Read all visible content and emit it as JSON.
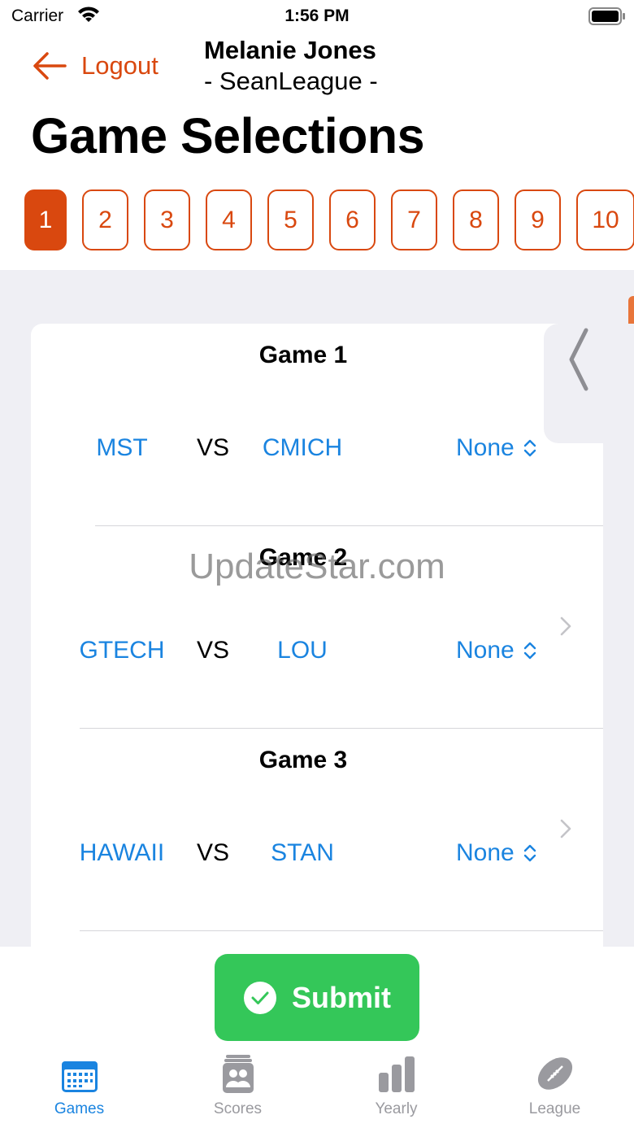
{
  "status_bar": {
    "carrier": "Carrier",
    "time": "1:56 PM"
  },
  "header": {
    "logout_label": "Logout",
    "user_name": "Melanie Jones",
    "league": "- SeanLeague -",
    "title": "Game Selections"
  },
  "weeks": [
    "1",
    "2",
    "3",
    "4",
    "5",
    "6",
    "7",
    "8",
    "9",
    "10"
  ],
  "selected_week": "1",
  "games": [
    {
      "title": "Game 1",
      "team_a": "MST",
      "vs": "VS",
      "team_b": "CMICH",
      "pick": "None"
    },
    {
      "title": "Game 2",
      "team_a": "GTECH",
      "vs": "VS",
      "team_b": "LOU",
      "pick": "None"
    },
    {
      "title": "Game 3",
      "team_a": "HAWAII",
      "vs": "VS",
      "team_b": "STAN",
      "pick": "None"
    }
  ],
  "watermark": "UpdateStar.com",
  "submit_label": "Submit",
  "tabs": [
    {
      "label": "Games",
      "icon": "calendar-icon",
      "active": true
    },
    {
      "label": "Scores",
      "icon": "scores-icon",
      "active": false
    },
    {
      "label": "Yearly",
      "icon": "bar-chart-icon",
      "active": false
    },
    {
      "label": "League",
      "icon": "football-icon",
      "active": false
    }
  ],
  "colors": {
    "accent": "#d9480f",
    "link": "#1a84e0",
    "submit": "#34c759",
    "background": "#efeff4"
  }
}
